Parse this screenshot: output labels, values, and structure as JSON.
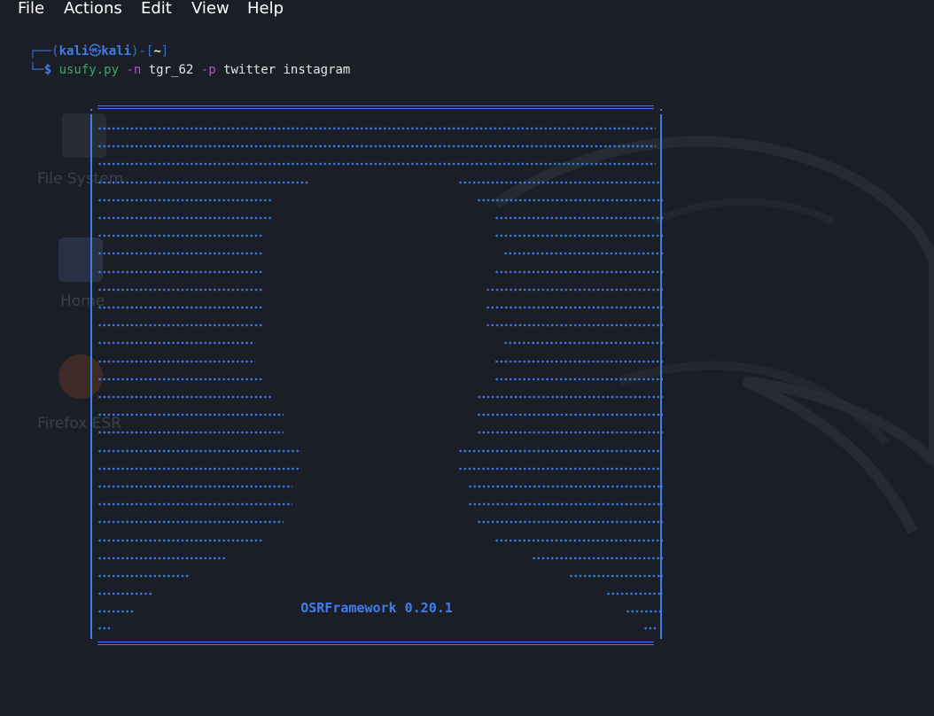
{
  "menubar": {
    "items": [
      "File",
      "Actions",
      "Edit",
      "View",
      "Help"
    ]
  },
  "prompt": {
    "frame_top": "┌──(",
    "user": "kali",
    "skull": "㉿",
    "host": "kali",
    "mid": ")-[",
    "dir": "~",
    "close": "]",
    "frame_bottom": "└─",
    "symbol": "$ "
  },
  "command": {
    "program": "usufy.py",
    "flag_n": "-n",
    "username": "tgr_62",
    "flag_p": "-p",
    "platforms": "twitter instagram"
  },
  "banner": {
    "title": "OSRFramework 0.20.1"
  },
  "desktop": {
    "icons": [
      "File System",
      "Home",
      "Firefox ESR"
    ]
  },
  "colors": {
    "accent": "#3f7ee8",
    "command": "#3aa86b",
    "flag": "#b057c9",
    "background": "#1b1e26"
  }
}
